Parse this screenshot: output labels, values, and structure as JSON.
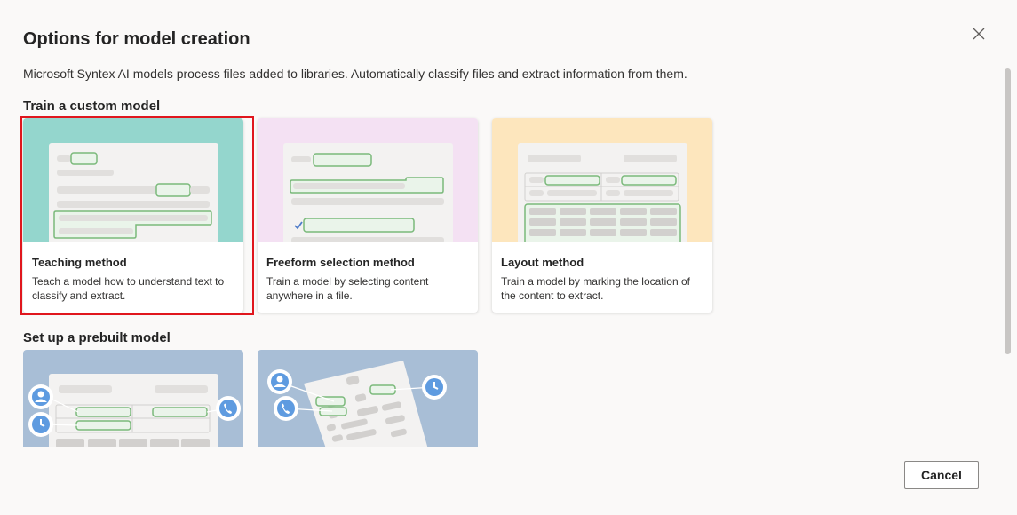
{
  "dialog": {
    "title": "Options for model creation",
    "description": "Microsoft Syntex AI models process files added to libraries. Automatically classify files and extract information from them.",
    "close_icon": "close-icon"
  },
  "custom_section": {
    "heading": "Train a custom model",
    "cards": [
      {
        "title": "Teaching method",
        "description": "Teach a model how to understand text to classify and extract.",
        "art_color": "#94d6cd",
        "selected": true
      },
      {
        "title": "Freeform selection method",
        "description": "Train a model by selecting content anywhere in a file.",
        "art_color": "#f4e1f3",
        "selected": false
      },
      {
        "title": "Layout method",
        "description": "Train a model by marking the location of the content to extract.",
        "art_color": "#fde6bd",
        "selected": false
      }
    ]
  },
  "prebuilt_section": {
    "heading": "Set up a prebuilt model",
    "art_color": "#a8bed6"
  },
  "footer": {
    "cancel_label": "Cancel"
  },
  "colors": {
    "highlight_green": "#7bb97b",
    "selection_outline": "#e0161d",
    "icon_blue": "#5e9be0"
  }
}
